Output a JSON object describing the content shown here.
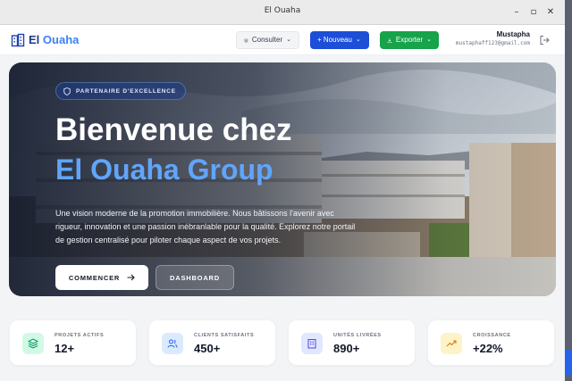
{
  "window": {
    "title": "El Ouaha"
  },
  "brand": {
    "part1": "El",
    "part2": "Ouaha"
  },
  "toolbar": {
    "consulter": "Consulter",
    "nouveau": "+ Nouveau",
    "exporter": "Exporter"
  },
  "user": {
    "name": "Mustapha",
    "email": "mustaphaff123@gmail.com"
  },
  "hero": {
    "badge": "PARTENAIRE D'EXCELLENCE",
    "title_line1": "Bienvenue chez",
    "title_line2": "El Ouaha Group",
    "description": "Une vision moderne de la promotion immobilière. Nous bâtissons l'avenir avec rigueur, innovation et une passion inébranlable pour la qualité. Explorez notre portail de gestion centralisé pour piloter chaque aspect de vos projets.",
    "cta_primary": "COMMENCER",
    "cta_secondary": "DASHBOARD"
  },
  "stats": [
    {
      "label": "PROJETS ACTIFS",
      "value": "12+",
      "icon": "layers-icon",
      "color": "#059669",
      "bg": "#d1fae5"
    },
    {
      "label": "CLIENTS SATISFAITS",
      "value": "450+",
      "icon": "users-icon",
      "color": "#2563eb",
      "bg": "#dbeafe"
    },
    {
      "label": "UNITÉS LIVRÉES",
      "value": "890+",
      "icon": "building-icon",
      "color": "#4f46e5",
      "bg": "#e0e7ff"
    },
    {
      "label": "CROISSANCE",
      "value": "+22%",
      "icon": "trend-up-icon",
      "color": "#d97706",
      "bg": "#fef3c7"
    }
  ],
  "colors": {
    "primary": "#1d4ed8",
    "export": "#16a34a",
    "accent": "#60a5fa"
  }
}
